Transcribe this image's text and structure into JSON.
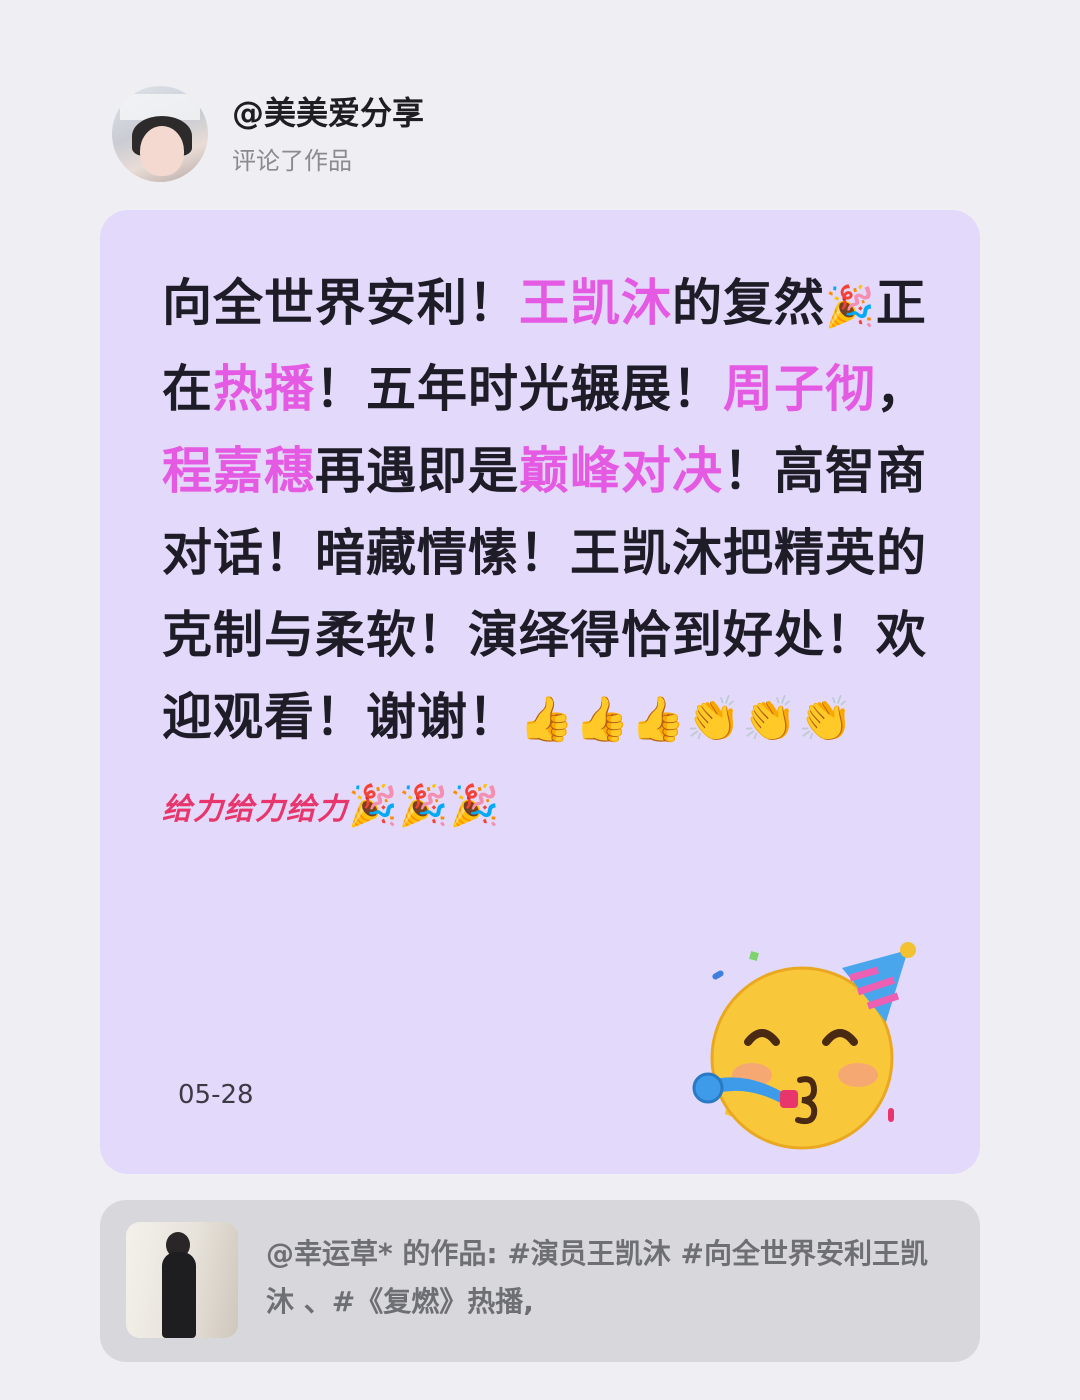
{
  "header": {
    "username": "@美美爱分享",
    "action": "评论了作品"
  },
  "comment": {
    "segments": [
      {
        "text": "向全世界安利！",
        "hl": false
      },
      {
        "text": "王凯沐",
        "hl": true
      },
      {
        "text": "的复然",
        "hl": false
      },
      {
        "text": "🎉",
        "emoji": true
      },
      {
        "text": "正在",
        "hl": false
      },
      {
        "text": "热播",
        "hl": true
      },
      {
        "text": "！五年时光辗展！",
        "hl": false
      },
      {
        "text": "周子彻",
        "hl": true
      },
      {
        "text": "，",
        "hl": false
      },
      {
        "text": "程嘉穗",
        "hl": true
      },
      {
        "text": "再遇即是",
        "hl": false
      },
      {
        "text": "巅峰对决",
        "hl": true
      },
      {
        "text": "！高智商对话！暗藏情愫！王凯沐把精英的克制与柔软！演绎得恰到好处！欢迎观看！谢谢！",
        "hl": false
      }
    ],
    "end_emojis": [
      "👍",
      "👍",
      "👍",
      "👏",
      "👏",
      "👏"
    ],
    "tail_text": "给力给力给力",
    "tail_emojis": [
      "🎉",
      "🎉",
      "🎉"
    ],
    "date": "05-28",
    "sticker_icon": "party-face-icon"
  },
  "work": {
    "description": "@幸运草* 的作品: #演员王凯沐 #向全世界安利王凯沐 、#《复燃》热播,"
  },
  "colors": {
    "background": "#efeef3",
    "comment_card": "#e3d9fb",
    "highlight": "#e45ae3",
    "tail_text": "#e8366c",
    "work_card": "#d8d8dc"
  }
}
